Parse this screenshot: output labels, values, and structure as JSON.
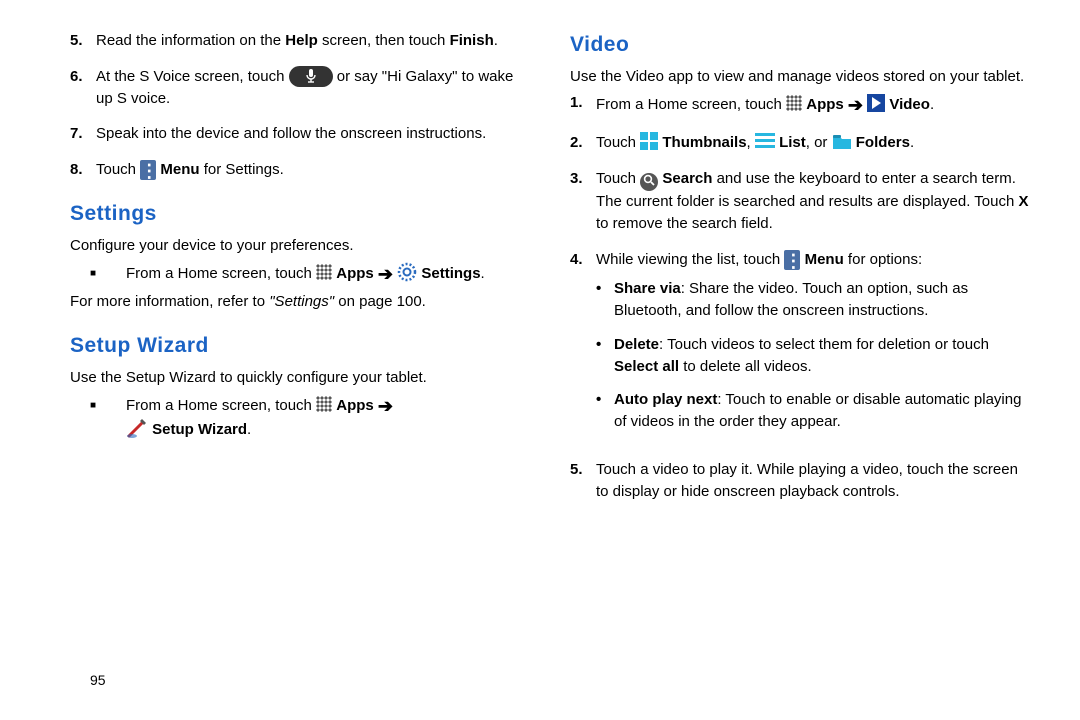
{
  "left": {
    "steps": [
      {
        "n": "5.",
        "pre": "Read the information on the ",
        "b": "Help",
        "mid": " screen, then touch ",
        "b2": "Finish",
        "post": "."
      },
      {
        "n": "6.",
        "text": "At the S Voice screen, touch ",
        "tail": " or say \"Hi Galaxy\" to wake up S voice."
      },
      {
        "n": "7.",
        "text": "Speak into the device and follow the onscreen instructions."
      },
      {
        "n": "8.",
        "pre": "Touch ",
        "b": "Menu",
        "post": " for Settings."
      }
    ],
    "h_settings": "Settings",
    "settings_intro": "Configure your device to your preferences.",
    "settings_bullet_pre": "From a Home screen, touch ",
    "settings_bullet_apps": "Apps",
    "settings_bullet_settings": "Settings",
    "settings_more_pre": "For more information, refer to ",
    "settings_more_i": "\"Settings\"",
    "settings_more_post": " on page 100.",
    "h_setup": "Setup Wizard",
    "setup_intro": "Use the Setup Wizard to quickly configure your tablet.",
    "setup_bullet_pre": "From a Home screen, touch ",
    "setup_bullet_apps": "Apps",
    "setup_bullet_wiz": "Setup Wizard"
  },
  "right": {
    "h_video": "Video",
    "video_intro": "Use the Video app to view and manage videos stored on your tablet.",
    "s1_pre": "From a Home screen, touch ",
    "s1_apps": "Apps",
    "s1_video": "Video",
    "s2_pre": "Touch ",
    "s2_thumb": "Thumbnails",
    "s2_list": "List",
    "s2_fold": "Folders",
    "s3_pre": "Touch ",
    "s3_search": "Search",
    "s3_mid": " and use the keyboard to enter a search term. The current folder is searched and results are displayed. Touch ",
    "s3_x": "X",
    "s3_post": " to remove the search field.",
    "s4_pre": "While viewing the list, touch ",
    "s4_menu": "Menu",
    "s4_post": " for options:",
    "sub": [
      {
        "b": "Share via",
        "t": ": Share the video. Touch an option, such as Bluetooth, and follow the onscreen instructions."
      },
      {
        "b": "Delete",
        "t": ": Touch videos to select them for deletion or touch ",
        "b2": "Select all",
        "t2": " to delete all videos."
      },
      {
        "b": "Auto play next",
        "t": ": Touch to enable or disable automatic playing of videos in the order they appear."
      }
    ],
    "s5": "Touch a video to play it. While playing a video, touch the screen to display or hide onscreen playback controls."
  },
  "page": "95"
}
